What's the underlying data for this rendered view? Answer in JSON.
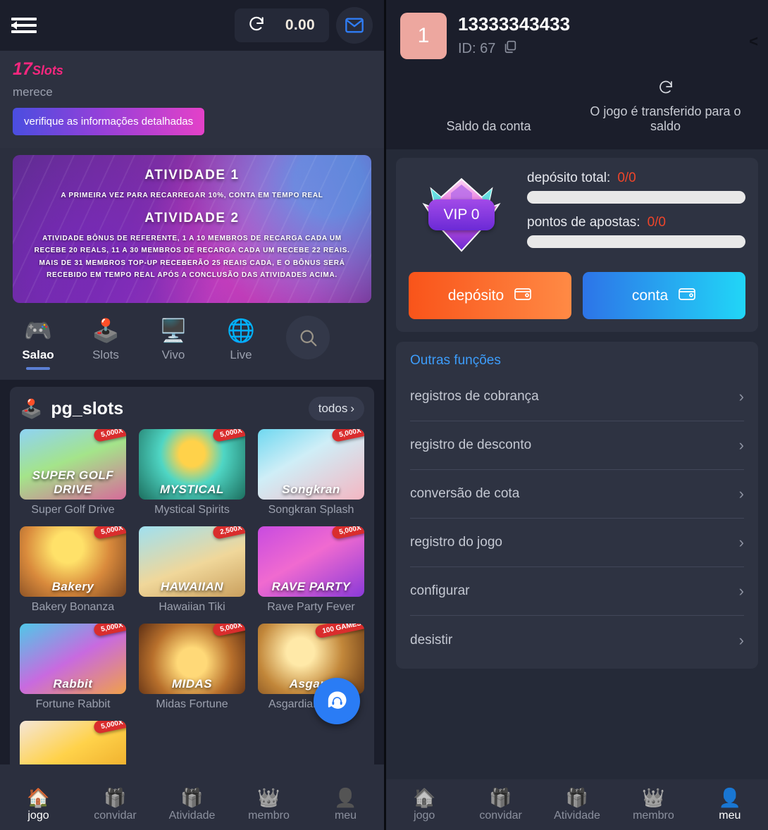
{
  "left": {
    "topbar": {
      "menu_icon": "hamburger-collapse-icon",
      "refresh_icon": "refresh-icon",
      "balance": "0.00",
      "mail_icon": "mail-icon"
    },
    "promo": {
      "title_number": "17",
      "title_word": "Slots",
      "subtitle": "merece",
      "button": "verifique as informações detalhadas"
    },
    "banner": {
      "heading1": "ATIVIDADE 1",
      "text1": "A PRIMEIRA VEZ PARA RECARREGAR 10%, CONTA EM TEMPO REAL",
      "heading2": "ATIVIDADE 2",
      "text2": "ATIVIDADE BÔNUS DE REFERENTE, 1 A 10 MEMBROS DE RECARGA CADA UM RECEBE 20 REALS, 11 A 30 MEMBROS DE RECARGA CADA UM RECEBE 22 REAIS. MAIS DE 31 MEMBROS TOP-UP RECEBERÃO 25 REAIS CADA, E O BÔNUS SERÁ RECEBIDO EM TEMPO REAL APÓS A CONCLUSÃO DAS ATIVIDADES ACIMA."
    },
    "categories": [
      {
        "label": "Salao",
        "icon": "gamepad-icon",
        "active": true
      },
      {
        "label": "Slots",
        "icon": "slot-machine-icon",
        "active": false
      },
      {
        "label": "Vivo",
        "icon": "live-screen-icon",
        "active": false
      },
      {
        "label": "Live",
        "icon": "globe-icon",
        "active": false
      }
    ],
    "search_icon": "search-icon",
    "section": {
      "icon": "slot-machine-icon",
      "title": "pg_slots",
      "all_label": "todos"
    },
    "games": [
      {
        "name": "Super Golf Drive",
        "badge": "5,000X",
        "logo": "SUPER GOLF DRIVE"
      },
      {
        "name": "Mystical Spirits",
        "badge": "5,000X",
        "logo": "MYSTICAL"
      },
      {
        "name": "Songkran Splash",
        "badge": "5,000X",
        "logo": "Songkran"
      },
      {
        "name": "Bakery Bonanza",
        "badge": "5,000X",
        "logo": "Bakery"
      },
      {
        "name": "Hawaiian Tiki",
        "badge": "2,500X",
        "logo": "HAWAIIAN"
      },
      {
        "name": "Rave Party Fever",
        "badge": "5,000X",
        "logo": "RAVE PARTY"
      },
      {
        "name": "Fortune Rabbit",
        "badge": "5,000X",
        "logo": "Rabbit"
      },
      {
        "name": "Midas Fortune",
        "badge": "5,000X",
        "logo": "MIDAS"
      },
      {
        "name": "Asgardian Rising",
        "badge": "100 GAMES",
        "logo": "Asgard"
      }
    ],
    "chat_icon": "support-chat-icon",
    "bottom_nav": [
      {
        "label": "jogo",
        "icon": "home-icon",
        "active": true
      },
      {
        "label": "convidar",
        "icon": "gift-icon",
        "active": false
      },
      {
        "label": "Atividade",
        "icon": "gift-icon",
        "active": false
      },
      {
        "label": "membro",
        "icon": "crown-icon",
        "active": false
      },
      {
        "label": "meu",
        "icon": "person-icon",
        "active": false
      }
    ]
  },
  "right": {
    "header": {
      "avatar_text": "1",
      "username": "13333343433",
      "id_label": "ID: 67",
      "copy_icon": "copy-icon",
      "back_icon": "chevron-left-icon",
      "balance_label": "Saldo da conta",
      "transfer_icon": "refresh-icon",
      "transfer_label": "O jogo é transferido para o saldo"
    },
    "vip": {
      "level": "VIP 0",
      "deposit_label": "depósito total:",
      "deposit_value": "0/0",
      "points_label": "pontos de apostas:",
      "points_value": "0/0",
      "deposit_button": "depósito",
      "account_button": "conta",
      "wallet_icon": "wallet-icon"
    },
    "functions": {
      "title": "Outras funções",
      "items": [
        {
          "label": "registros de cobrança"
        },
        {
          "label": "registro de desconto"
        },
        {
          "label": "conversão de cota"
        },
        {
          "label": "registro do jogo"
        },
        {
          "label": "configurar"
        },
        {
          "label": "desistir"
        }
      ]
    },
    "bottom_nav": [
      {
        "label": "jogo",
        "icon": "home-icon",
        "active": false
      },
      {
        "label": "convidar",
        "icon": "gift-icon",
        "active": false
      },
      {
        "label": "Atividade",
        "icon": "gift-icon",
        "active": false
      },
      {
        "label": "membro",
        "icon": "crown-icon",
        "active": false
      },
      {
        "label": "meu",
        "icon": "person-icon",
        "active": true
      }
    ]
  },
  "colors": {
    "accent_pink": "#f5277e",
    "accent_blue": "#3d9dfb",
    "deposit_orange": "#f9541a",
    "account_blue": "#2d74e8",
    "value_red": "#f0452a",
    "panel_bg": "#2b2f3e",
    "dark_bg": "#1b1e2b"
  }
}
